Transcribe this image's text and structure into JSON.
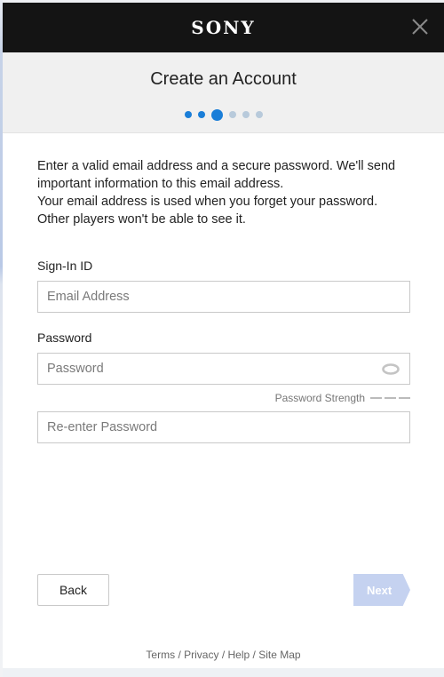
{
  "header": {
    "logo": "SONY",
    "close_icon": "close-icon"
  },
  "subheader": {
    "title": "Create an Account",
    "steps": {
      "total": 6,
      "current": 3,
      "states": [
        "done",
        "done",
        "current",
        "pending",
        "pending",
        "pending"
      ]
    }
  },
  "intro": {
    "line1": "Enter a valid email address and a secure password. We'll send important information to this email address.",
    "line2": "Your email address is used when you forget your password. Other players won't be able to see it."
  },
  "form": {
    "signin_label": "Sign-In ID",
    "email": {
      "value": "",
      "placeholder": "Email Address"
    },
    "password_label": "Password",
    "password": {
      "value": "",
      "placeholder": "Password",
      "toggle_icon": "eye-icon"
    },
    "strength_label": "Password Strength",
    "strength_level": 0,
    "reenter": {
      "value": "",
      "placeholder": "Re-enter Password"
    }
  },
  "actions": {
    "back_label": "Back",
    "next_label": "Next",
    "next_disabled": true
  },
  "footer": {
    "links": [
      "Terms",
      "Privacy",
      "Help",
      "Site Map"
    ],
    "separator": "/"
  },
  "colors": {
    "accent": "#1a7ed8",
    "step_pending": "#b8cadb",
    "next_disabled": "#c5d2f0",
    "header_bg": "#141414"
  }
}
